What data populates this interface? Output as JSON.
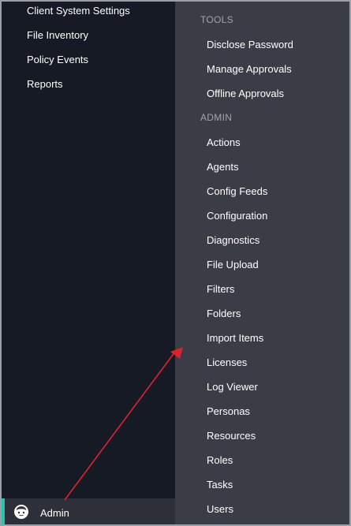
{
  "left_nav": {
    "items": [
      {
        "label": "Client System Settings"
      },
      {
        "label": "File Inventory"
      },
      {
        "label": "Policy Events"
      },
      {
        "label": "Reports"
      }
    ],
    "admin": {
      "label": "Admin",
      "icon": "user-face-icon",
      "accent_color": "#27c4ae"
    }
  },
  "flyout": {
    "tools_header": "TOOLS",
    "tools": [
      {
        "label": "Disclose Password"
      },
      {
        "label": "Manage Approvals"
      },
      {
        "label": "Offline Approvals"
      }
    ],
    "admin_header": "ADMIN",
    "admin_items": [
      {
        "label": "Actions"
      },
      {
        "label": "Agents"
      },
      {
        "label": "Config Feeds"
      },
      {
        "label": "Configuration"
      },
      {
        "label": "Diagnostics"
      },
      {
        "label": "File Upload"
      },
      {
        "label": "Filters"
      },
      {
        "label": "Folders"
      },
      {
        "label": "Import Items"
      },
      {
        "label": "Licenses"
      },
      {
        "label": "Log Viewer"
      },
      {
        "label": "Personas"
      },
      {
        "label": "Resources"
      },
      {
        "label": "Roles"
      },
      {
        "label": "Tasks"
      },
      {
        "label": "Users"
      }
    ]
  },
  "annotation": {
    "color": "#e0202e"
  }
}
